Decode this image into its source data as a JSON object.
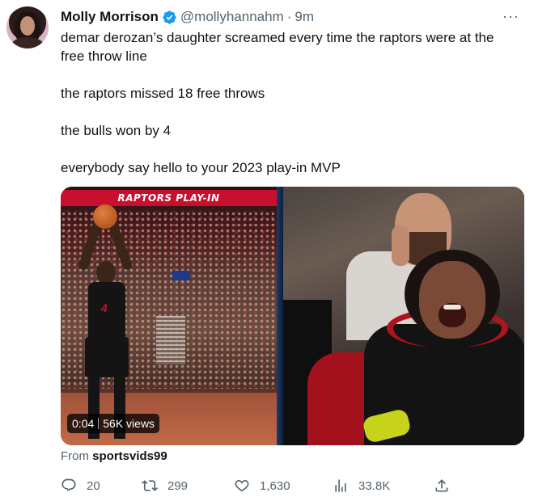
{
  "author": {
    "name": "Molly Morrison",
    "handle": "@mollyhannahm",
    "separator": "·",
    "time": "9m"
  },
  "tweet": {
    "paragraphs": [
      "demar derozan’s daughter screamed every time the raptors were at the free throw line",
      "the raptors missed 18 free throws",
      "the bulls won by 4",
      "everybody say hello to your 2023 play-in MVP"
    ],
    "line1a": "demar derozan’s daughter screamed every time the raptors were at the",
    "line1b": "free throw line"
  },
  "media": {
    "banner_text": "RAPTORS PLAY-IN",
    "video_time": "0:04",
    "video_views": "56K views",
    "jersey_number": "4"
  },
  "source": {
    "prefix": "From",
    "account": "sportsvids99"
  },
  "actions": {
    "replies": "20",
    "retweets": "299",
    "likes": "1,630",
    "views": "33.8K"
  },
  "icons": {
    "verified": "verified-badge-icon",
    "more": "more-dots-icon",
    "reply": "reply-icon",
    "retweet": "retweet-icon",
    "like": "heart-icon",
    "views": "views-chart-icon",
    "share": "share-icon"
  },
  "colors": {
    "verified_blue": "#1d9bf0",
    "text": "#0f1419",
    "muted": "#536471"
  }
}
